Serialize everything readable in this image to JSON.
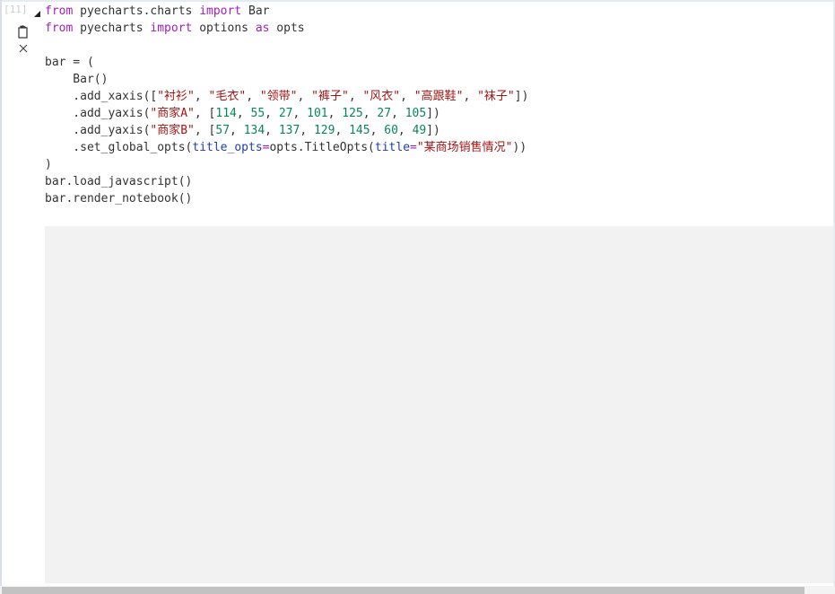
{
  "cell": {
    "prompt": "[11]",
    "code_lines": [
      [
        {
          "t": "from",
          "c": "kw"
        },
        {
          "t": " pyecharts.charts "
        },
        {
          "t": "import",
          "c": "kw"
        },
        {
          "t": " Bar"
        }
      ],
      [
        {
          "t": "from",
          "c": "kw"
        },
        {
          "t": " pyecharts "
        },
        {
          "t": "import",
          "c": "kw"
        },
        {
          "t": " options "
        },
        {
          "t": "as",
          "c": "kw"
        },
        {
          "t": " opts"
        }
      ],
      [],
      [
        {
          "t": "bar = ("
        }
      ],
      [
        {
          "t": "    Bar()"
        }
      ],
      [
        {
          "t": "    .add_xaxis(["
        },
        {
          "t": "\"衬衫\"",
          "c": "str"
        },
        {
          "t": ", "
        },
        {
          "t": "\"毛衣\"",
          "c": "str"
        },
        {
          "t": ", "
        },
        {
          "t": "\"领带\"",
          "c": "str"
        },
        {
          "t": ", "
        },
        {
          "t": "\"裤子\"",
          "c": "str"
        },
        {
          "t": ", "
        },
        {
          "t": "\"风衣\"",
          "c": "str"
        },
        {
          "t": ", "
        },
        {
          "t": "\"高跟鞋\"",
          "c": "str"
        },
        {
          "t": ", "
        },
        {
          "t": "\"袜子\"",
          "c": "str"
        },
        {
          "t": "])"
        }
      ],
      [
        {
          "t": "    .add_yaxis("
        },
        {
          "t": "\"商家A\"",
          "c": "str"
        },
        {
          "t": ", ["
        },
        {
          "t": "114",
          "c": "num"
        },
        {
          "t": ", "
        },
        {
          "t": "55",
          "c": "num"
        },
        {
          "t": ", "
        },
        {
          "t": "27",
          "c": "num"
        },
        {
          "t": ", "
        },
        {
          "t": "101",
          "c": "num"
        },
        {
          "t": ", "
        },
        {
          "t": "125",
          "c": "num"
        },
        {
          "t": ", "
        },
        {
          "t": "27",
          "c": "num"
        },
        {
          "t": ", "
        },
        {
          "t": "105",
          "c": "num"
        },
        {
          "t": "])"
        }
      ],
      [
        {
          "t": "    .add_yaxis("
        },
        {
          "t": "\"商家B\"",
          "c": "str"
        },
        {
          "t": ", ["
        },
        {
          "t": "57",
          "c": "num"
        },
        {
          "t": ", "
        },
        {
          "t": "134",
          "c": "num"
        },
        {
          "t": ", "
        },
        {
          "t": "137",
          "c": "num"
        },
        {
          "t": ", "
        },
        {
          "t": "129",
          "c": "num"
        },
        {
          "t": ", "
        },
        {
          "t": "145",
          "c": "num"
        },
        {
          "t": ", "
        },
        {
          "t": "60",
          "c": "num"
        },
        {
          "t": ", "
        },
        {
          "t": "49",
          "c": "num"
        },
        {
          "t": "])"
        }
      ],
      [
        {
          "t": "    .set_global_opts("
        },
        {
          "t": "title_opts",
          "c": "prm"
        },
        {
          "t": "=",
          "c": "eq"
        },
        {
          "t": "opts.TitleOpts("
        },
        {
          "t": "title",
          "c": "prm"
        },
        {
          "t": "=",
          "c": "eq"
        },
        {
          "t": "\"某商场销售情况\"",
          "c": "str"
        },
        {
          "t": "))"
        }
      ],
      [
        {
          "t": ")"
        }
      ],
      [
        {
          "t": "bar.load_javascript()"
        }
      ],
      [
        {
          "t": "bar.render_notebook()"
        }
      ]
    ]
  },
  "toolbar": {
    "copy_icon": "copy-icon",
    "close_icon": "close-icon"
  },
  "colors": {
    "keyword": "#a11fbf",
    "string": "#a31515",
    "number": "#098658",
    "param": "#1f3fa8",
    "output_bg": "#f2f2f2"
  }
}
